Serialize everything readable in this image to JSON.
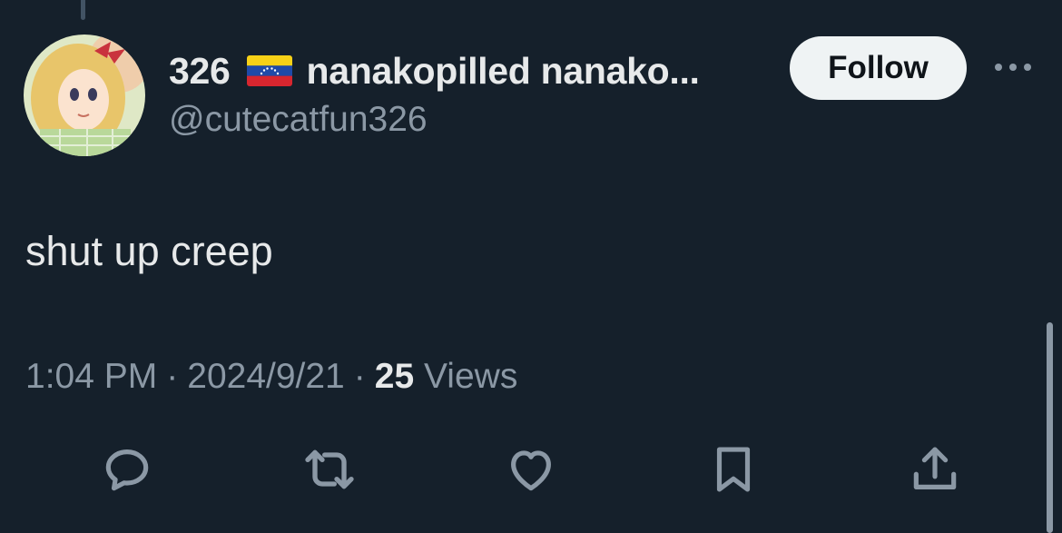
{
  "post": {
    "author": {
      "display_name": "326",
      "flag_icon": "venezuela-flag-icon",
      "display_name_suffix": "nanakopilled nanako...",
      "handle": "@cutecatfun326"
    },
    "follow_label": "Follow",
    "more_icon": "more-options-icon",
    "text": "shut up creep",
    "meta": {
      "time": "1:04 PM",
      "separator": "·",
      "date": "2024/9/21",
      "views_count": "25",
      "views_label": "Views"
    },
    "actions": [
      {
        "name": "reply",
        "icon": "reply-icon"
      },
      {
        "name": "repost",
        "icon": "repost-icon"
      },
      {
        "name": "like",
        "icon": "heart-icon"
      },
      {
        "name": "bookmark",
        "icon": "bookmark-icon"
      },
      {
        "name": "share",
        "icon": "share-icon"
      }
    ]
  },
  "colors": {
    "background": "#15202b",
    "primary_text": "#e7e9ea",
    "secondary_text": "#8b98a5",
    "follow_button_bg": "#eff3f4",
    "follow_button_text": "#0f1419"
  }
}
